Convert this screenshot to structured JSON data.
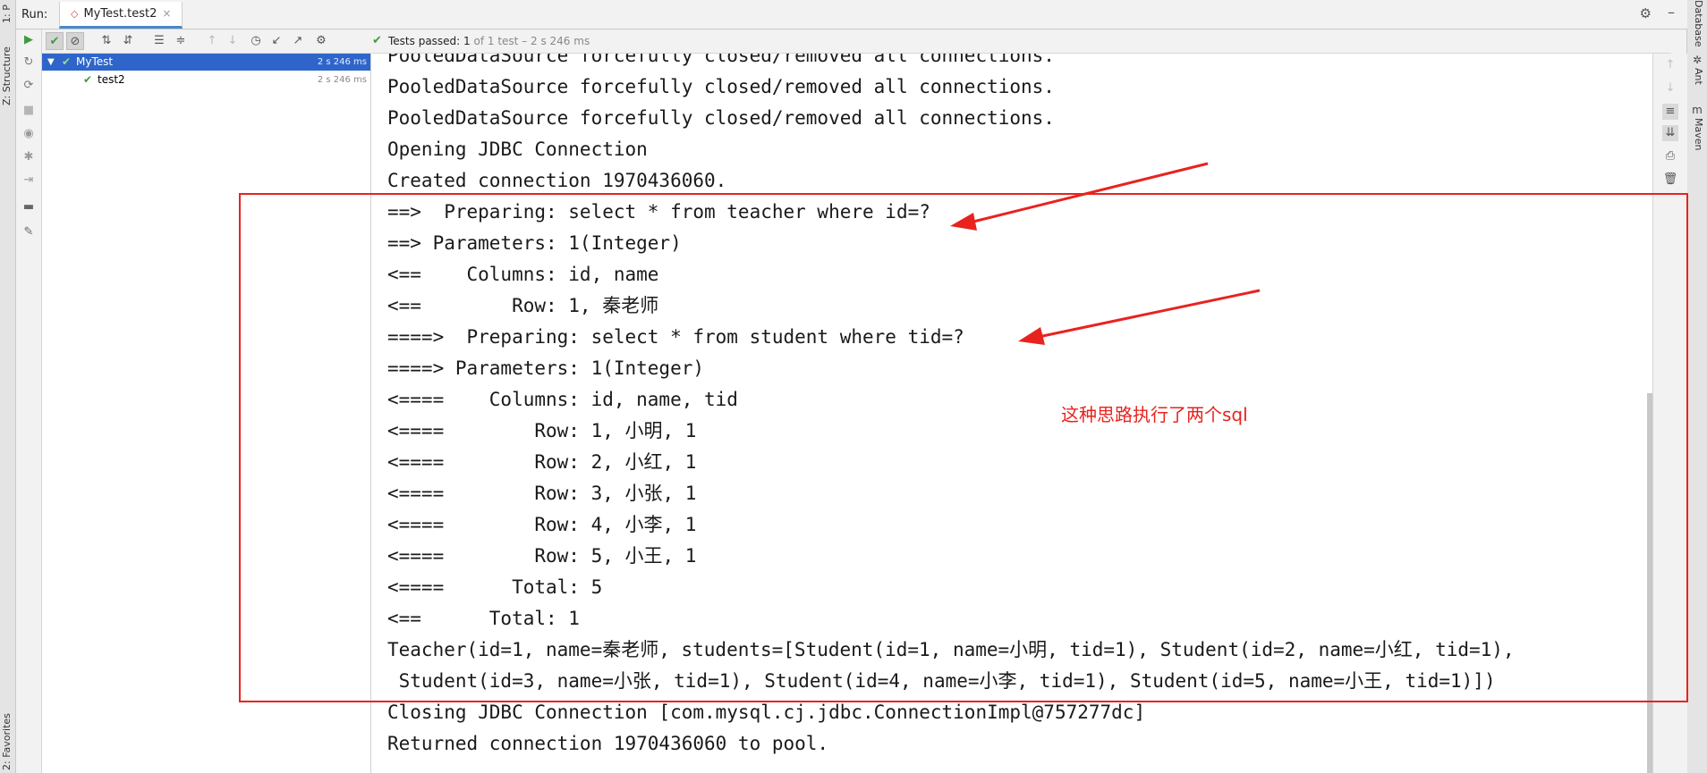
{
  "left_stripe": {
    "tab_top": "1: P",
    "tab_structure": "Z: Structure",
    "tab_favorites": "2: Favorites"
  },
  "right_stripe": {
    "tab_database": "Database",
    "tab_ant": "Ant",
    "tab_maven": "Maven"
  },
  "run_header": {
    "label": "Run:",
    "tab_title": "MyTest.test2",
    "tab_close": "×"
  },
  "status": {
    "prefix": "Tests passed:",
    "count": "1",
    "detail": "of 1 test – 2 s 246 ms"
  },
  "tree": {
    "root": {
      "name": "MyTest",
      "time": "2 s 246 ms"
    },
    "child": {
      "name": "test2",
      "time": "2 s 246 ms"
    }
  },
  "console": {
    "lines": [
      "PooledDataSource forcefully closed/removed all connections.",
      "PooledDataSource forcefully closed/removed all connections.",
      "PooledDataSource forcefully closed/removed all connections.",
      "Opening JDBC Connection",
      "Created connection 1970436060.",
      "==>  Preparing: select * from teacher where id=?",
      "==> Parameters: 1(Integer)",
      "<==    Columns: id, name",
      "<==        Row: 1, 秦老师",
      "====>  Preparing: select * from student where tid=?",
      "====> Parameters: 1(Integer)",
      "<====    Columns: id, name, tid",
      "<====        Row: 1, 小明, 1",
      "<====        Row: 2, 小红, 1",
      "<====        Row: 3, 小张, 1",
      "<====        Row: 4, 小李, 1",
      "<====        Row: 5, 小王, 1",
      "<====      Total: 5",
      "<==      Total: 1",
      "Teacher(id=1, name=秦老师, students=[Student(id=1, name=小明, tid=1), Student(id=2, name=小红, tid=1),",
      " Student(id=3, name=小张, tid=1), Student(id=4, name=小李, tid=1), Student(id=5, name=小王, tid=1)])",
      "Closing JDBC Connection [com.mysql.cj.jdbc.ConnectionImpl@757277dc]",
      "Returned connection 1970436060 to pool."
    ]
  },
  "annotation": {
    "text": "这种思路执行了两个sql",
    "color": "#e8231e"
  },
  "colors": {
    "selection": "#2f65ca",
    "pass_green": "#3f9b3f",
    "tab_underline": "#4a88c7"
  },
  "icons": {
    "run": "play-icon",
    "rerun_failed": "rerun-icon",
    "stop": "stop-icon",
    "show_passed": "check-icon",
    "show_ignored": "ban-icon",
    "sort_alpha": "sort-alpha-icon",
    "sort_duration": "sort-duration-icon",
    "expand": "expand-all-icon",
    "collapse": "collapse-all-icon",
    "prev": "arrow-up-icon",
    "next": "arrow-down-icon",
    "history": "history-icon",
    "import": "import-icon",
    "export": "export-icon",
    "settings": "gear-icon"
  }
}
